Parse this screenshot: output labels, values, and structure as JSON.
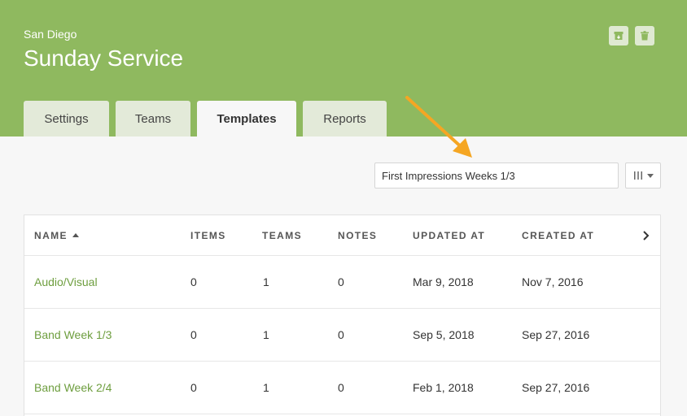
{
  "header": {
    "subtitle": "San Diego",
    "title": "Sunday Service",
    "actions": [
      "archive-icon",
      "trash-icon"
    ],
    "background_color": "#8fb95f"
  },
  "tabs": [
    {
      "label": "Settings",
      "active": false
    },
    {
      "label": "Teams",
      "active": false
    },
    {
      "label": "Templates",
      "active": true
    },
    {
      "label": "Reports",
      "active": false
    }
  ],
  "toolbar": {
    "filter_value": "First Impressions Weeks 1/3",
    "columns_icon": "columns-icon"
  },
  "annotation": {
    "color": "#f5a623"
  },
  "table": {
    "columns": [
      "Name",
      "Items",
      "Teams",
      "Notes",
      "Updated At",
      "Created At"
    ],
    "sorted_column": "Name",
    "sort_direction": "asc",
    "rows": [
      [
        "Audio/Visual",
        "0",
        "1",
        "0",
        "Mar 9, 2018",
        "Nov 7, 2016"
      ],
      [
        "Band Week 1/3",
        "0",
        "1",
        "0",
        "Sep 5, 2018",
        "Sep 27, 2016"
      ],
      [
        "Band Week 2/4",
        "0",
        "1",
        "0",
        "Feb 1, 2018",
        "Sep 27, 2016"
      ]
    ]
  }
}
